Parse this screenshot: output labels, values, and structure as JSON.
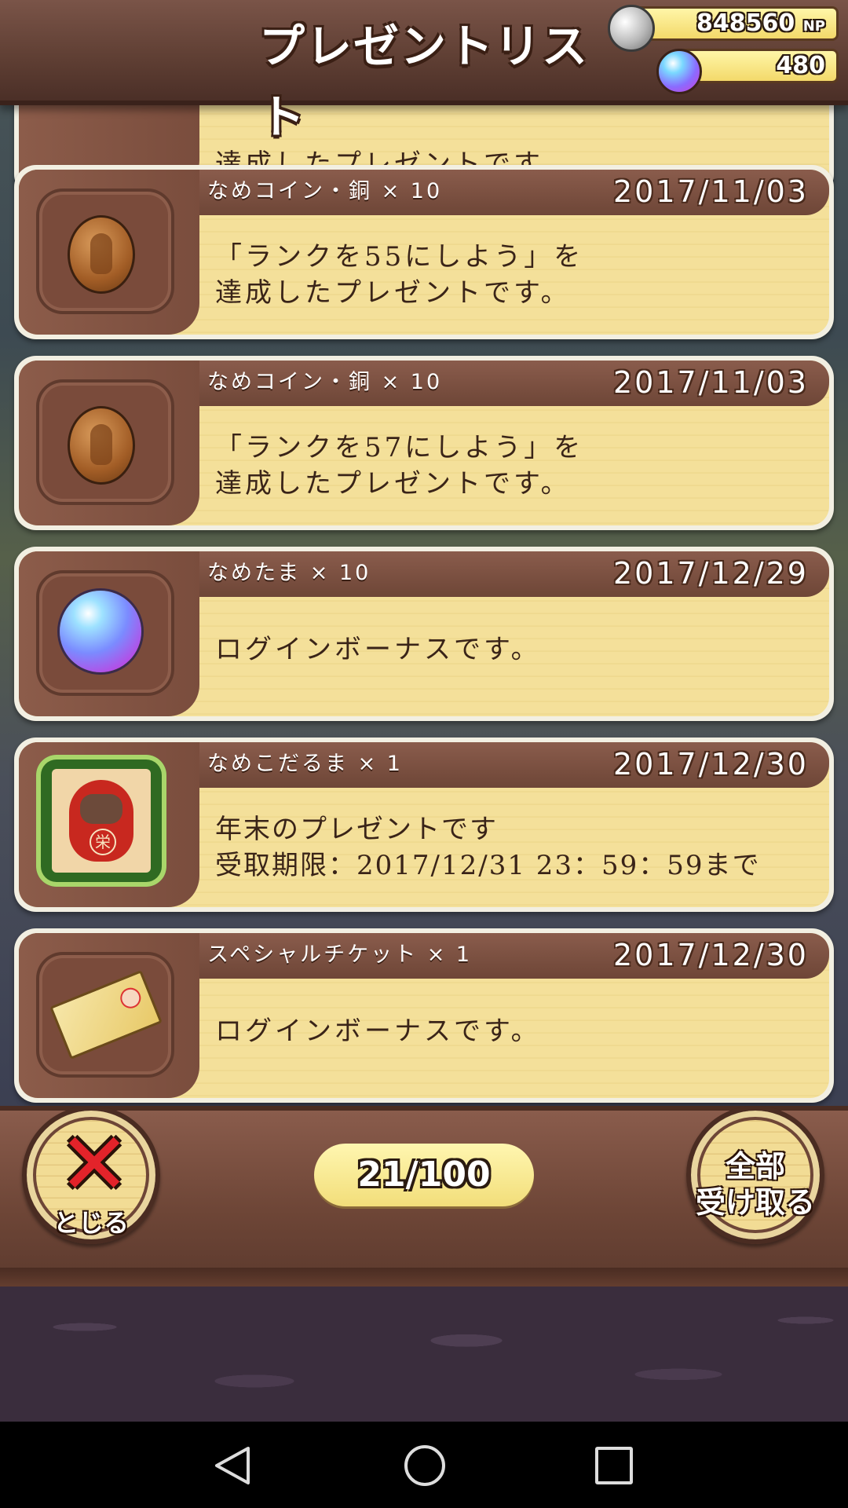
{
  "header": {
    "title": "プレゼントリスト",
    "np_amount": "848560",
    "np_unit": "NP",
    "gem_amount": "480"
  },
  "items": [
    {
      "name": "",
      "date": "",
      "message": "達成したプレゼントです。",
      "icon": "bronze-coin-icon"
    },
    {
      "name": "なめコイン・銅 × 10",
      "date": "2017/11/03",
      "message_lines": [
        "「ランクを55にしよう」を",
        "達成したプレゼントです。"
      ],
      "icon": "bronze-coin-icon"
    },
    {
      "name": "なめコイン・銅 × 10",
      "date": "2017/11/03",
      "message_lines": [
        "「ランクを57にしよう」を",
        "達成したプレゼントです。"
      ],
      "icon": "bronze-coin-icon"
    },
    {
      "name": "なめたま × 10",
      "date": "2017/12/29",
      "message_lines": [
        "ログインボーナスです。"
      ],
      "icon": "gem-icon"
    },
    {
      "name": "なめこだるま × 1",
      "date": "2017/12/30",
      "message_lines": [
        "年末のプレゼントです",
        "受取期限：2017/12/31 23：59：59まで"
      ],
      "icon": "daruma-icon"
    },
    {
      "name": "スペシャルチケット × 1",
      "date": "2017/12/30",
      "message_lines": [
        "ログインボーナスです。"
      ],
      "icon": "ticket-icon"
    }
  ],
  "footer": {
    "close_label": "とじる",
    "count": "21/100",
    "receive_all_line1": "全部",
    "receive_all_line2": "受け取る"
  },
  "colors": {
    "accent_red": "#e3232a",
    "wood": "#7a4d3d",
    "parchment": "#f4e09a"
  }
}
